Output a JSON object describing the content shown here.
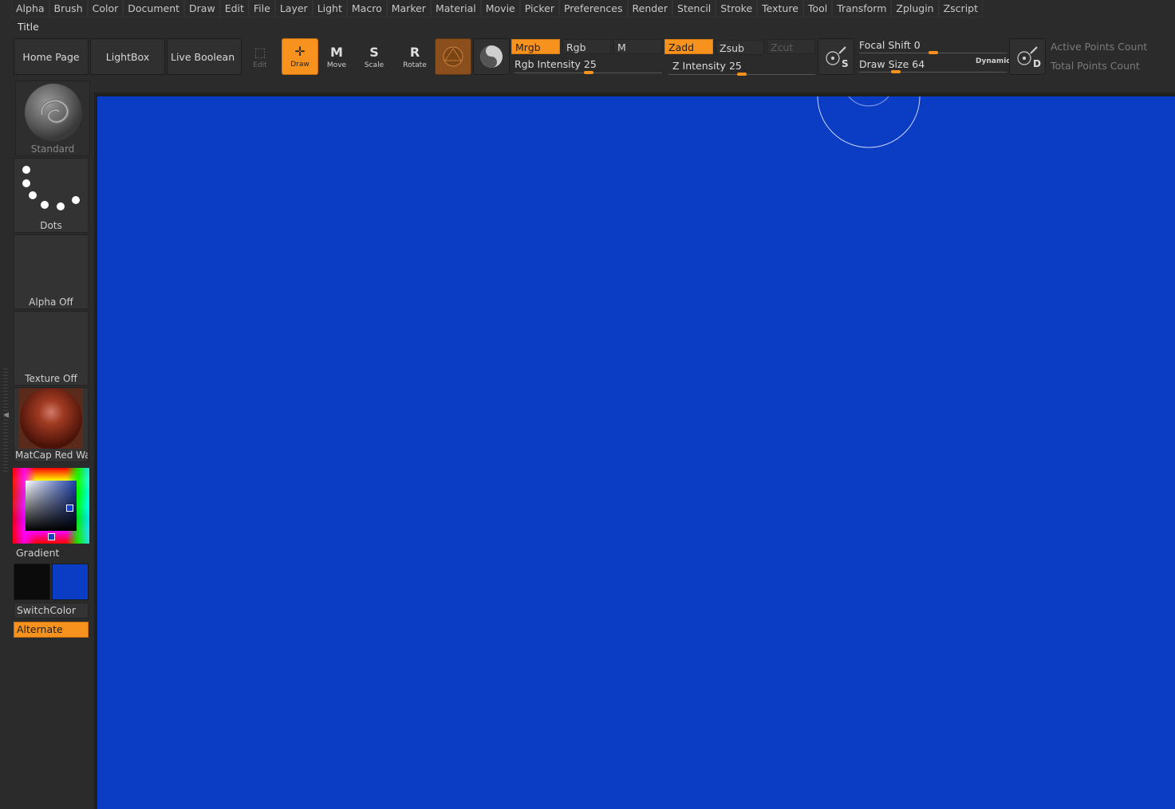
{
  "menu": [
    "Alpha",
    "Brush",
    "Color",
    "Document",
    "Draw",
    "Edit",
    "File",
    "Layer",
    "Light",
    "Macro",
    "Marker",
    "Material",
    "Movie",
    "Picker",
    "Preferences",
    "Render",
    "Stencil",
    "Stroke",
    "Texture",
    "Tool",
    "Transform",
    "Zplugin",
    "Zscript"
  ],
  "title": "Title",
  "shelf": {
    "home_page": "Home Page",
    "lightbox": "LightBox",
    "live_boolean": "Live Boolean",
    "tools": {
      "edit": {
        "label": "Edit",
        "glyph": "⬚"
      },
      "draw": {
        "label": "Draw",
        "glyph": "✛"
      },
      "move": {
        "label": "Move",
        "glyph": "M"
      },
      "scale": {
        "label": "Scale",
        "glyph": "S"
      },
      "rotate": {
        "label": "Rotate",
        "glyph": "R"
      }
    },
    "modes": {
      "mrgb": "Mrgb",
      "rgb": "Rgb",
      "m": "M",
      "zadd": "Zadd",
      "zsub": "Zsub",
      "zcut": "Zcut"
    },
    "sliders": {
      "rgb_intensity": {
        "label": "Rgb Intensity",
        "value": "25",
        "fraction": 0.25
      },
      "z_intensity": {
        "label": "Z Intensity",
        "value": "25",
        "fraction": 0.25
      },
      "focal_shift": {
        "label": "Focal Shift",
        "value": "0",
        "fraction": 0.5
      },
      "draw_size": {
        "label": "Draw Size",
        "value": "64",
        "fraction": 0.25
      }
    },
    "dynamic_label": "Dynamic",
    "s_label": "S",
    "d_label": "D",
    "active_points": "Active Points Count",
    "total_points": "Total Points Count"
  },
  "tray": {
    "brush": "Standard",
    "stroke": "Dots",
    "alpha": "Alpha Off",
    "texture": "Texture Off",
    "material": "MatCap Red Wax",
    "gradient": "Gradient",
    "switch_color": "SwitchColor",
    "alternate": "Alternate"
  },
  "colors": {
    "accent": "#f7921e",
    "canvas": "#0b3dc4",
    "primary_color": "#0b0b0b",
    "secondary_color": "#0b3dc4"
  }
}
